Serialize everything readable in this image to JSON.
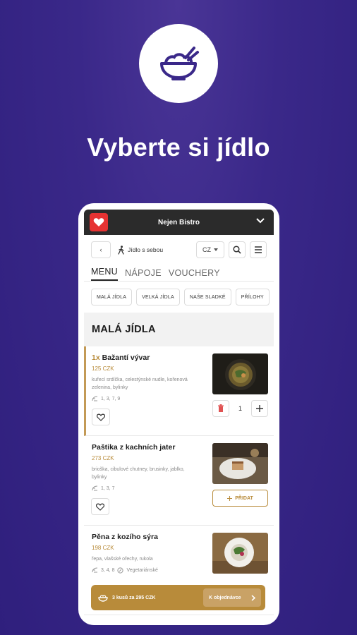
{
  "hero": {
    "title": "Vyberte si jídlo",
    "icon": "rice-bowl-icon"
  },
  "header": {
    "restaurant_name": "Nejen Bistro"
  },
  "toolbar": {
    "back_label": "‹",
    "mode_label": "Jídlo s sebou",
    "language": "CZ"
  },
  "tabs": [
    {
      "label": "MENU",
      "active": true
    },
    {
      "label": "NÁPOJE",
      "active": false
    },
    {
      "label": "VOUCHERY",
      "active": false
    }
  ],
  "categories": [
    "MALÁ JÍDLA",
    "VELKÁ JÍDLA",
    "NAŠE SLADKÉ",
    "PŘÍLOHY"
  ],
  "section_title": "MALÁ JÍDLA",
  "items": [
    {
      "qty_prefix": "1x",
      "name": "Bažantí vývar",
      "price": "125 CZK",
      "description": "kuřecí srdíčka, celestýnské nudle, kořenová zelenina, bylinky",
      "allergens": "1, 3, 7, 9",
      "quantity": "1"
    },
    {
      "name": "Paštika z kachních jater",
      "price": "273 CZK",
      "description": "brioška, cibulové chutney, brusinky, jablko, bylinky",
      "allergens": "1, 3, 7",
      "add_label": "PŘIDAT"
    },
    {
      "name": "Pěna z kozího sýra",
      "price": "198 CZK",
      "description": "řepa, vlašské ořechy, rukola",
      "allergens": "3, 4, 8",
      "tag": "Vegetariánské"
    }
  ],
  "order": {
    "summary": "3 kusů za 295 CZK",
    "button_label": "K objednávce"
  },
  "colors": {
    "background": "#35247f",
    "accent": "#b88b3a",
    "logo": "#e63232",
    "topbar": "#2b2b2b"
  }
}
